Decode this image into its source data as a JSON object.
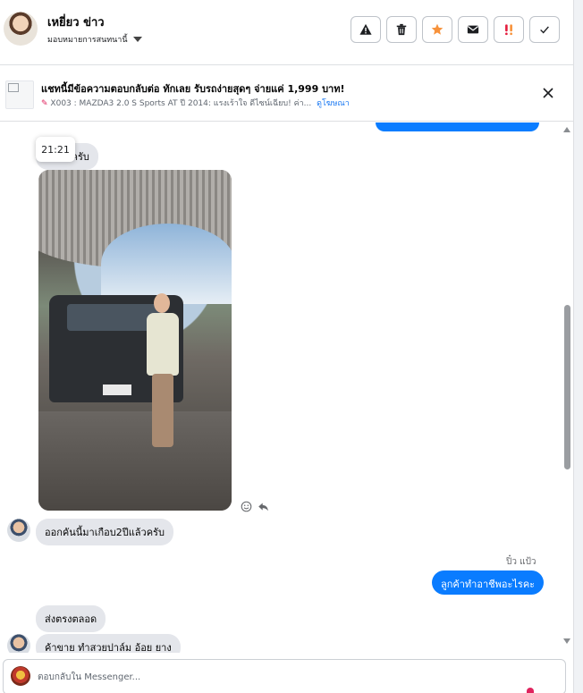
{
  "header": {
    "name": "เหยี่ยว ข่าว",
    "assign_label": "มอบหมายการสนทนานี้",
    "toolbar": [
      {
        "name": "report-spam-button",
        "icon": "warning-icon"
      },
      {
        "name": "delete-button",
        "icon": "trash-icon"
      },
      {
        "name": "star-button",
        "icon": "star-icon"
      },
      {
        "name": "mark-unread-button",
        "icon": "envelope-icon"
      },
      {
        "name": "follow-up-button",
        "icon": "exclamation-icon"
      },
      {
        "name": "mark-done-button",
        "icon": "checkmark-icon"
      }
    ]
  },
  "ad": {
    "title": "แชทนี้มีข้อความตอบกลับต่อ ทักเลย รับรถง่ายสุดๆ จ่ายแค่ 1,999 บาท!",
    "subtitle": "X003 : MAZDA3 2.0 S Sports AT ปี 2014: แรงเร้าใจ ดีไซน์เฉียบ! ค่า...",
    "link_label": "ดูโฆษณา"
  },
  "chat": {
    "tooltip_time": "21:21",
    "messages": {
      "m1": "แนนชัครับ",
      "m2": "ออกคันนี้มาเกือบ2ปีแล้วครับ",
      "page_sender": "ปิ๋ว แป้ว",
      "page_reply": "ลูกค้าทำอาชีพอะไรคะ",
      "m3": "ส่งตรงตลอด",
      "m4": "ค้าขาย ทำสวยปาล์ม อ้อย ยาง"
    }
  },
  "composer": {
    "placeholder": "ตอบกลับใน Messenger..."
  },
  "colors": {
    "accent_blue": "#0a7cff",
    "star_orange": "#f7923b",
    "alert_red": "#e41e3f"
  }
}
